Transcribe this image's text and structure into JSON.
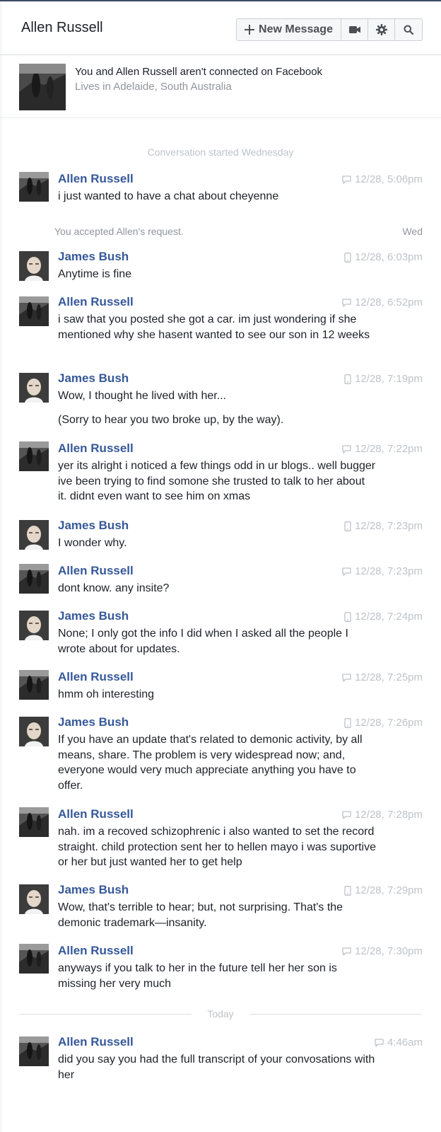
{
  "header": {
    "title": "Allen Russell",
    "new_message_label": "New Message",
    "icons": [
      "plus-icon",
      "video-icon",
      "gear-icon",
      "search-icon"
    ]
  },
  "profile": {
    "line1": "You and Allen Russell aren't connected on Facebook",
    "line2": "Lives in Adelaide, South Australia"
  },
  "conversation_started": "Conversation started Wednesday",
  "accepted": {
    "text": "You accepted Allen's request.",
    "day": "Wed"
  },
  "today_label": "Today",
  "colors": {
    "name": "#365899",
    "meta": "#bec3c9",
    "text": "#1d2129"
  },
  "messages": [
    {
      "sender": "Allen Russell",
      "avatar": "allen",
      "device": "chat",
      "time": "12/28, 5:06pm",
      "body": [
        "i just wanted to have a chat about cheyenne"
      ]
    },
    {
      "sender": "James Bush",
      "avatar": "james",
      "device": "mobile",
      "time": "12/28, 6:03pm",
      "body": [
        "Anytime is fine"
      ]
    },
    {
      "sender": "Allen Russell",
      "avatar": "allen",
      "device": "chat",
      "time": "12/28, 6:52pm",
      "body": [
        "i saw that you posted she got a car. im just wondering if she mentioned why she hasent wanted to see our son in 12 weeks"
      ]
    },
    {
      "sender": "James Bush",
      "avatar": "james",
      "device": "mobile",
      "time": "12/28, 7:19pm",
      "body": [
        "Wow, I thought he lived with her...",
        "(Sorry to hear you two broke up, by the way)."
      ]
    },
    {
      "sender": "Allen Russell",
      "avatar": "allen",
      "device": "chat",
      "time": "12/28, 7:22pm",
      "body": [
        "yer its alright i noticed a few things odd in ur blogs.. well bugger ive been trying to find somone she trusted to talk to her about it. didnt even want to see him on xmas"
      ]
    },
    {
      "sender": "James Bush",
      "avatar": "james",
      "device": "mobile",
      "time": "12/28, 7:23pm",
      "body": [
        "I wonder why."
      ]
    },
    {
      "sender": "Allen Russell",
      "avatar": "allen",
      "device": "chat",
      "time": "12/28, 7:23pm",
      "body": [
        "dont know. any insite?"
      ]
    },
    {
      "sender": "James Bush",
      "avatar": "james",
      "device": "mobile",
      "time": "12/28, 7:24pm",
      "body": [
        "None; I only got the info I did when I asked all the people I wrote about for updates."
      ]
    },
    {
      "sender": "Allen Russell",
      "avatar": "allen",
      "device": "chat",
      "time": "12/28, 7:25pm",
      "body": [
        "hmm oh interesting"
      ]
    },
    {
      "sender": "James Bush",
      "avatar": "james",
      "device": "mobile",
      "time": "12/28, 7:26pm",
      "body": [
        "If you have an update that's related to demonic activity, by all means, share. The problem is very widespread now; and, everyone would very much appreciate anything you have to offer."
      ]
    },
    {
      "sender": "Allen Russell",
      "avatar": "allen",
      "device": "chat",
      "time": "12/28, 7:28pm",
      "body": [
        "nah. im a recoved schizophrenic i also wanted to set the record straight. child protection sent her to hellen mayo i was suportive or her but just wanted her to get help"
      ]
    },
    {
      "sender": "James Bush",
      "avatar": "james",
      "device": "mobile",
      "time": "12/28, 7:29pm",
      "body": [
        "Wow, that's terrible to hear; but, not surprising. That's the demonic trademark—insanity."
      ]
    },
    {
      "sender": "Allen Russell",
      "avatar": "allen",
      "device": "chat",
      "time": "12/28, 7:30pm",
      "body": [
        "anyways if you talk to her in the future tell her her son is missing her very much"
      ]
    },
    {
      "sender": "Allen Russell",
      "avatar": "allen",
      "device": "chat",
      "time": "4:46am",
      "body": [
        "did you say you had the full transcript of your convosations with her"
      ]
    }
  ]
}
